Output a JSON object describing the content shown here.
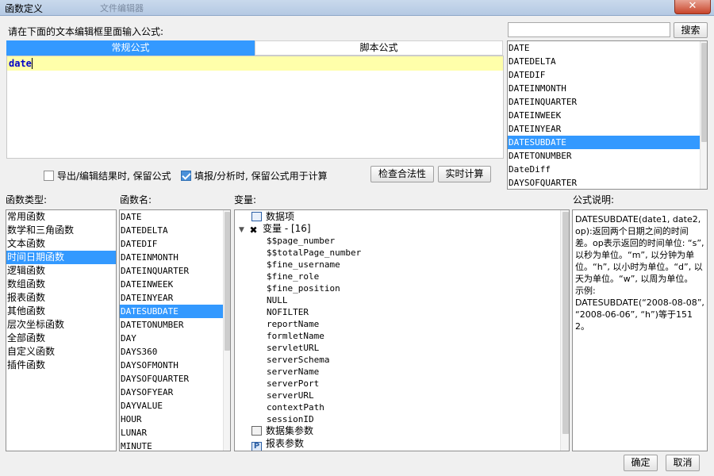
{
  "window": {
    "title": "函数定义",
    "close_label": "✕",
    "ghost_tab": "文件编辑器"
  },
  "editor": {
    "instruction": "请在下面的文本编辑框里面输入公式:",
    "tabs": [
      {
        "label": "常规公式"
      },
      {
        "label": "脚本公式"
      }
    ],
    "formula_text": "date"
  },
  "search": {
    "value": "",
    "button_label": "搜索"
  },
  "suggestions": [
    "DATE",
    "DATEDELTA",
    "DATEDIF",
    "DATEINMONTH",
    "DATEINQUARTER",
    "DATEINWEEK",
    "DATEINYEAR",
    "DATESUBDATE",
    "DATETONUMBER",
    "DateDiff",
    "DAYSOFQUARTER"
  ],
  "options": {
    "export_keep": {
      "label": "导出/编辑结果时, 保留公式",
      "checked": false
    },
    "fill_keep": {
      "label": "填报/分析时, 保留公式用于计算",
      "checked": true
    },
    "check_button": "检查合法性",
    "realtime_button": "实时计算"
  },
  "headers": {
    "func_type": "函数类型:",
    "func_name": "函数名:",
    "variables": "变量:",
    "description": "公式说明:"
  },
  "func_types": [
    "常用函数",
    "数学和三角函数",
    "文本函数",
    "时间日期函数",
    "逻辑函数",
    "数组函数",
    "报表函数",
    "其他函数",
    "层次坐标函数",
    "全部函数",
    "自定义函数",
    "插件函数"
  ],
  "func_names": [
    "DATE",
    "DATEDELTA",
    "DATEDIF",
    "DATEINMONTH",
    "DATEINQUARTER",
    "DATEINWEEK",
    "DATEINYEAR",
    "DATESUBDATE",
    "DATETONUMBER",
    "DAY",
    "DAYS360",
    "DAYSOFMONTH",
    "DAYSOFQUARTER",
    "DAYSOFYEAR",
    "DAYVALUE",
    "HOUR",
    "LUNAR",
    "MINUTE"
  ],
  "variables": {
    "data_items": "数据项",
    "var_group": "变量 - [16]",
    "var_items": [
      "$$page_number",
      "$$totalPage_number",
      "$fine_username",
      "$fine_role",
      "$fine_position",
      "NULL",
      "NOFILTER",
      "reportName",
      "formletName",
      "servletURL",
      "serverSchema",
      "serverName",
      "serverPort",
      "serverURL",
      "contextPath",
      "sessionID"
    ],
    "dataset_params": "数据集参数",
    "report_params": "报表参数"
  },
  "description_text": "DATESUBDATE(date1, date2, op):返回两个日期之间的时间差。op表示返回的时间单位: “s”, 以秒为单位。“m”, 以分钟为单位。“h”, 以小时为单位。“d”, 以天为单位。“w”, 以周为单位。\n示例:\nDATESUBDATE(“2008-08-08”, “2008-06-06”, “h”)等于1512。",
  "footer": {
    "ok_label": "确定",
    "cancel_label": "取消"
  },
  "colors": {
    "accent_blue": "#3399ff",
    "editor_line": "#ffffaa",
    "tab_selected": "#3399ff"
  }
}
